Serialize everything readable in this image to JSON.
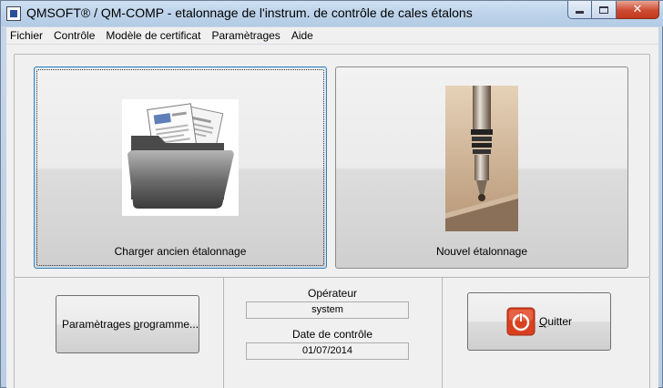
{
  "window": {
    "title": "QMSOFT® / QM-COMP - etalonnage de l'instrum. de contrôle de cales étalons",
    "controls": {
      "minimize_icon": "minimize-icon",
      "maximize_icon": "maximize-icon",
      "close_icon": "close-icon"
    }
  },
  "menubar": {
    "items": [
      "Fichier",
      "Contrôle",
      "Modèle de certificat",
      "Paramètrages",
      "Aide"
    ]
  },
  "main": {
    "load_button": {
      "label": "Charger ancien étalonnage",
      "icon": "folder-documents-icon"
    },
    "new_button": {
      "label": "Nouvel étalonnage",
      "icon": "measuring-probe-icon"
    },
    "settings_button": {
      "label_prefix": "Paramètrages ",
      "label_accel": "p",
      "label_suffix": "rogramme...",
      "icon": "checklist-icon"
    },
    "operator": {
      "label": "Opérateur",
      "value": "system"
    },
    "date": {
      "label": "Date de contrôle",
      "value": "01/07/2014"
    },
    "quit_button": {
      "label_accel": "Q",
      "label_suffix": "uitter",
      "icon": "power-icon",
      "icon_color": "#d9401f"
    }
  }
}
